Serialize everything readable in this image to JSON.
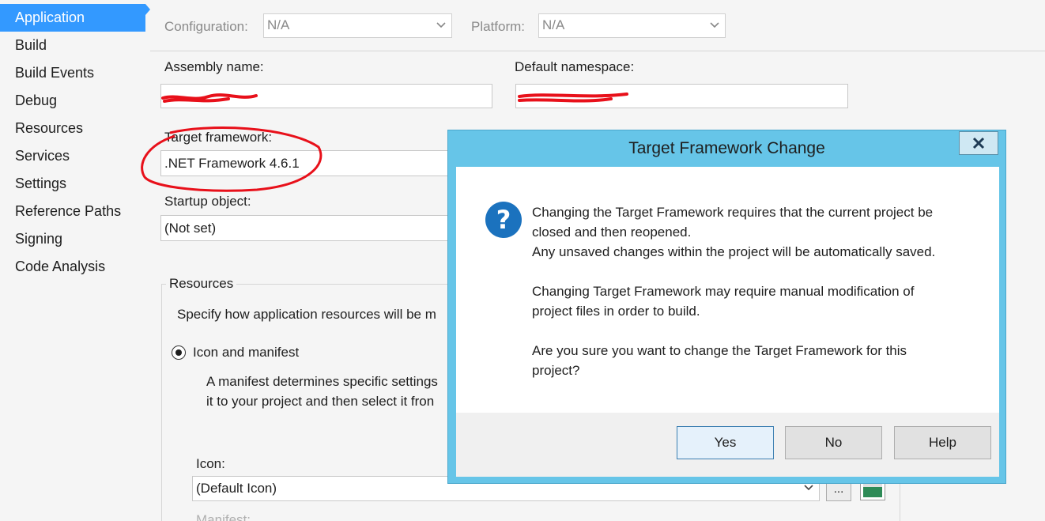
{
  "sidebar": {
    "items": [
      {
        "label": "Application",
        "active": true
      },
      {
        "label": "Build"
      },
      {
        "label": "Build Events"
      },
      {
        "label": "Debug"
      },
      {
        "label": "Resources"
      },
      {
        "label": "Services"
      },
      {
        "label": "Settings"
      },
      {
        "label": "Reference Paths"
      },
      {
        "label": "Signing"
      },
      {
        "label": "Code Analysis"
      }
    ]
  },
  "toolbar": {
    "configuration_label": "Configuration:",
    "configuration_value": "N/A",
    "platform_label": "Platform:",
    "platform_value": "N/A"
  },
  "application": {
    "assembly_name_label": "Assembly name:",
    "default_namespace_label": "Default namespace:",
    "target_framework_label": "Target framework:",
    "target_framework_value": ".NET Framework 4.6.1",
    "startup_object_label": "Startup object:",
    "startup_object_value": "(Not set)"
  },
  "resources": {
    "group_label": "Resources",
    "description": "Specify how application resources will be m",
    "icon_and_manifest_label": "Icon and manifest",
    "manifest_line1": "A manifest determines specific settings",
    "manifest_line2": "it to your project and then select it fron",
    "icon_label": "Icon:",
    "icon_value": "(Default Icon)",
    "browse_label": "...",
    "manifest_label_partial": "Manifest:"
  },
  "dialog": {
    "title": "Target Framework Change",
    "close_label": "✕",
    "message_lines": [
      "Changing the Target Framework requires that the current project be",
      "closed and then reopened.",
      "Any unsaved changes within the project will be automatically saved.",
      "Changing Target Framework may require manual modification of",
      "project files in order to build.",
      "Are you sure you want to change the Target Framework for this",
      "project?"
    ],
    "buttons": {
      "yes": "Yes",
      "no": "No",
      "help": "Help"
    }
  },
  "colors": {
    "accent": "#3399ff",
    "dialog_frame": "#66c5e8",
    "annotation": "#e8101a",
    "question_icon": "#1b72be"
  },
  "icons": {
    "dialog_icon": "question-icon",
    "close": "close-icon",
    "dropdown": "chevron-down-icon"
  }
}
